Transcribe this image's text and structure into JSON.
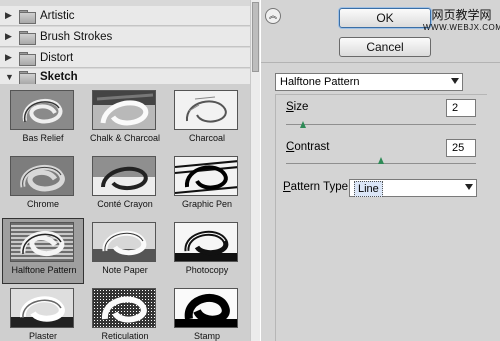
{
  "categories": [
    {
      "label": "Artistic",
      "open": false
    },
    {
      "label": "Brush Strokes",
      "open": false
    },
    {
      "label": "Distort",
      "open": false
    },
    {
      "label": "Sketch",
      "open": true
    }
  ],
  "thumbnails": [
    {
      "label": "Bas Relief",
      "selected": false
    },
    {
      "label": "Chalk & Charcoal",
      "selected": false
    },
    {
      "label": "Charcoal",
      "selected": false
    },
    {
      "label": "Chrome",
      "selected": false
    },
    {
      "label": "Conté Crayon",
      "selected": false
    },
    {
      "label": "Graphic Pen",
      "selected": false
    },
    {
      "label": "Halftone Pattern",
      "selected": true
    },
    {
      "label": "Note Paper",
      "selected": false
    },
    {
      "label": "Photocopy",
      "selected": false
    },
    {
      "label": "Plaster",
      "selected": false
    },
    {
      "label": "Reticulation",
      "selected": false
    },
    {
      "label": "Stamp",
      "selected": false
    }
  ],
  "buttons": {
    "ok": "OK",
    "cancel": "Cancel"
  },
  "watermark": {
    "line1": "网页教学网",
    "line2": "WWW.WEBJX.COM"
  },
  "filter_select": {
    "value": "Halftone Pattern"
  },
  "params": {
    "size": {
      "label_u": "S",
      "label_rest": "ize",
      "value": "2",
      "min": 1,
      "max": 12
    },
    "contrast": {
      "label_u": "C",
      "label_rest": "ontrast",
      "value": "25",
      "min": 0,
      "max": 50
    }
  },
  "pattern_type": {
    "label_u": "P",
    "label_rest": "attern Type:",
    "value": "Line"
  }
}
